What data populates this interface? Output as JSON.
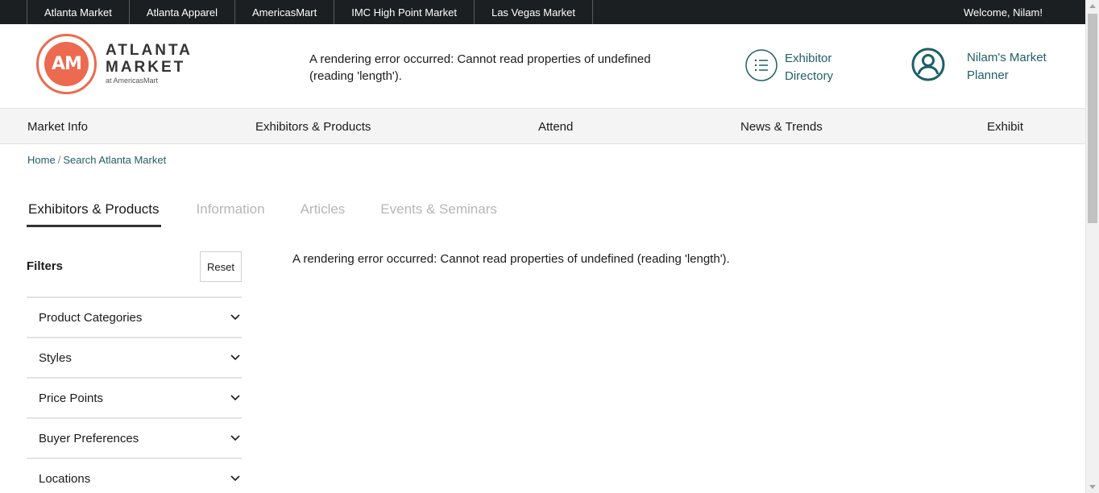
{
  "topbar": {
    "links": [
      "Atlanta Market",
      "Atlanta Apparel",
      "AmericasMart",
      "IMC High Point Market",
      "Las Vegas Market"
    ],
    "welcome": "Welcome, Nilam!"
  },
  "logo": {
    "icon_text": "AM",
    "line1": "ATLANTA",
    "line2": "MARKET",
    "sub": "at AmericasMart"
  },
  "header": {
    "error": "A rendering error occurred: Cannot read properties of undefined (reading 'length').",
    "exhibitor_directory": {
      "line1": "Exhibitor",
      "line2": "Directory",
      "icon": "list-icon"
    },
    "planner": {
      "line1": "Nilam's Market",
      "line2": "Planner",
      "icon": "user-icon"
    }
  },
  "nav": {
    "items": [
      "Market Info",
      "Exhibitors & Products",
      "Attend",
      "News & Trends",
      "Exhibit"
    ]
  },
  "breadcrumb": {
    "home": "Home",
    "separator": "/",
    "current": "Search Atlanta Market"
  },
  "tabs": {
    "items": [
      "Exhibitors & Products",
      "Information",
      "Articles",
      "Events & Seminars"
    ],
    "active": "Exhibitors & Products"
  },
  "filters": {
    "title": "Filters",
    "reset_label": "Reset",
    "items": [
      "Product Categories",
      "Styles",
      "Price Points",
      "Buyer Preferences",
      "Locations"
    ]
  },
  "main": {
    "error": "A rendering error occurred: Cannot read properties of undefined (reading 'length')."
  },
  "colors": {
    "brand": "#ec6a4f",
    "link": "#1f5f66",
    "topbar": "#1c1f21"
  }
}
